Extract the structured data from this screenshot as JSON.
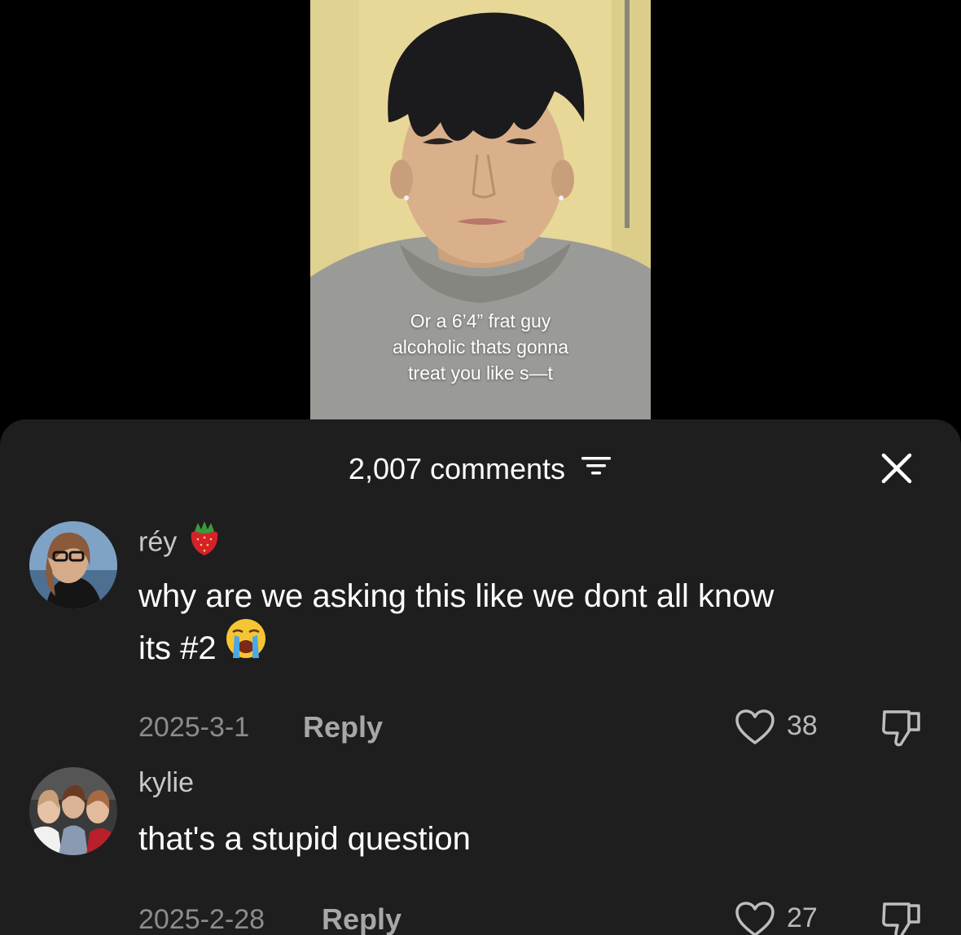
{
  "video": {
    "caption_lines": [
      "Or a 6’4” frat guy",
      "alcoholic thats gonna",
      "treat you like s—t"
    ]
  },
  "comments_panel": {
    "count_label": "2,007 comments",
    "icons": {
      "filter": "filter-icon",
      "close": "close-icon"
    },
    "comments": [
      {
        "username": "réy",
        "username_emoji": "strawberry-emoji",
        "text_line1": "why are we asking this like we dont all know",
        "text_line2": "its #2",
        "text_emoji": "loudly-crying-face-emoji",
        "date": "2025-3-1",
        "reply_label": "Reply",
        "likes": "38"
      },
      {
        "username": "kylie",
        "text_line1": "that's a stupid question",
        "date": "2025-2-28",
        "reply_label": "Reply",
        "likes": "27"
      }
    ]
  },
  "colors": {
    "sheet_background": "#1e1e1e",
    "page_background": "#000000",
    "text_primary": "#ffffff",
    "text_secondary": "#8c8c8c"
  }
}
